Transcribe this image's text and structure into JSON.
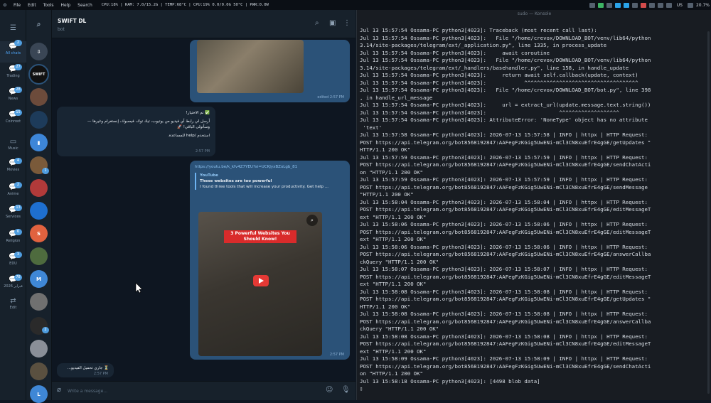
{
  "topbar": {
    "menu": [
      "File",
      "Edit",
      "Tools",
      "Help",
      "Search"
    ],
    "stats": "CPU:18% | RAM: 7.0/15.2G | TEMP:68°C | CPU:19% 0.0/0.0G 50°C | PWR:0.0W",
    "keyboard": "US",
    "battery": "20.7%"
  },
  "folders": [
    {
      "label": "All chats",
      "icon": "chat-bubbles-icon",
      "badge": "2",
      "active": true
    },
    {
      "label": "Trading",
      "icon": "chat-bubbles-icon",
      "badge": "27"
    },
    {
      "label": "News",
      "icon": "chat-bubbles-icon",
      "badge": "28"
    },
    {
      "label": "Coinroot",
      "icon": "chat-bubbles-icon",
      "badge": "15"
    },
    {
      "label": "Music",
      "icon": "folder-icon",
      "badge": ""
    },
    {
      "label": "Movies",
      "icon": "chat-bubbles-icon",
      "badge": "4"
    },
    {
      "label": "Anime",
      "icon": "chat-bubbles-icon",
      "badge": "2"
    },
    {
      "label": "Services",
      "icon": "chat-bubbles-icon",
      "badge": "13"
    },
    {
      "label": "Religion",
      "icon": "chat-bubbles-icon",
      "badge": "6"
    },
    {
      "label": "EDU",
      "icon": "chat-bubbles-icon",
      "badge": "3"
    },
    {
      "label": "2026 فبراير",
      "icon": "chat-bubbles-icon",
      "badge": "78"
    },
    {
      "label": "Edit",
      "icon": "sliders-icon",
      "badge": ""
    }
  ],
  "chats": [
    {
      "initial": "",
      "color": "#3a4655",
      "badge": ""
    },
    {
      "initial": "SWIFT",
      "color": "#111111",
      "badge": "",
      "selected": true
    },
    {
      "initial": "",
      "color": "#6c4b3b",
      "badge": ""
    },
    {
      "initial": "",
      "color": "#1d3b5a",
      "badge": ""
    },
    {
      "initial": "",
      "color": "#3d86d8",
      "badge": ""
    },
    {
      "initial": "",
      "color": "#7a5a3a",
      "badge": "1"
    },
    {
      "initial": "",
      "color": "#b13a3a",
      "badge": ""
    },
    {
      "initial": "",
      "color": "#1e6fd0",
      "badge": ""
    },
    {
      "initial": "S",
      "color": "#e1623f",
      "badge": ""
    },
    {
      "initial": "",
      "color": "#4e6b3e",
      "badge": ""
    },
    {
      "initial": "M",
      "color": "#3f87d6",
      "badge": ""
    },
    {
      "initial": "",
      "color": "#707070",
      "badge": ""
    },
    {
      "initial": "",
      "color": "#2a2a2a",
      "badge": "2"
    },
    {
      "initial": "",
      "color": "#8a8f98",
      "badge": ""
    },
    {
      "initial": "",
      "color": "#5a5040",
      "badge": ""
    },
    {
      "initial": "L",
      "color": "#3f87d6",
      "badge": ""
    }
  ],
  "chat": {
    "title": "SWIFT DL",
    "subtitle": "bot",
    "messages": {
      "first_time": "edited 2:57 PM",
      "welcome": "✅ تم الاختيار!",
      "welcome_body1": "أرسل لي رابط أي فيديو من يوتيوب، تيك توك، فيسبوك، إنستغرام وغيرها —",
      "welcome_body2": "وسأتولى الباقي! 🚀",
      "welcome_help": "استخدم /help للمساعدة.",
      "welcome_time": "2:57 PM",
      "link": "https://youtu.be/k_kfv4Z7YEU?si=UCKJyxBZoLgb_81",
      "preview_site": "YouTube",
      "preview_title": "These websites are too powerful",
      "preview_desc": "I found three tools that will increase your productivity. Get help ...",
      "video_caption": "3 Powerful Websites You Should Know!",
      "link_time": "2:57 PM",
      "loading": "⏳ جاري تحميل الفيديو...",
      "loading_time": "2:57 PM"
    },
    "composer_placeholder": "Write a message..."
  },
  "terminal": {
    "title": "sudo — Konsole",
    "lines": [
      "Jul 13 15:57:54 Ossama-PC python3[4023]: Traceback (most recent call last):",
      "Jul 13 15:57:54 Ossama-PC python3[4023]:   File \"/home/crevox/DOWNLOAD_BOT/venv/lib64/python",
      "3.14/site-packages/telegram/ext/_application.py\", line 1335, in process_update",
      "Jul 13 15:57:54 Ossama-PC python3[4023]:     await coroutine",
      "Jul 13 15:57:54 Ossama-PC python3[4023]:   File \"/home/crevox/DOWNLOAD_BOT/venv/lib64/python",
      "3.14/site-packages/telegram/ext/_handlers/basehandler.py\", line 158, in handle_update",
      "Jul 13 15:57:54 Ossama-PC python3[4023]:     return await self.callback(update, context)",
      "Jul 13 15:57:54 Ossama-PC python3[4023]:            ^^^^^^^^^^^^^^^^^^^^^^^^^^^^^^^^^^^^",
      "Jul 13 15:57:54 Ossama-PC python3[4023]:   File \"/home/crevox/DOWNLOAD_BOT/bot.py\", line 398",
      ", in handle_url_message",
      "Jul 13 15:57:54 Ossama-PC python3[4023]:     url = extract_url(update.message.text.string())",
      "Jul 13 15:57:54 Ossama-PC python3[4023]:                       ^^^^^^^^^^^^^^^^^^^",
      "Jul 13 15:57:54 Ossama-PC python3[4023]: AttributeError: 'NoneType' object has no attribute",
      " 'text'",
      "Jul 13 15:57:58 Ossama-PC python3[4023]: 2026-07-13 15:57:58 | INFO | httpx | HTTP Request:",
      "POST https://api.telegram.org/bot8568192847:AAFegFzKGig5UwENi-mCl3CN8xuEfrE4gGE/getUpdates \"",
      "HTTP/1.1 200 OK\"",
      "Jul 13 15:57:59 Ossama-PC python3[4023]: 2026-07-13 15:57:59 | INFO | httpx | HTTP Request:",
      "POST https://api.telegram.org/bot8568192847:AAFegFzKGig5UwENi-mCl3CN8xuEfrE4gGE/sendChatActi",
      "on \"HTTP/1.1 200 OK\"",
      "Jul 13 15:57:59 Ossama-PC python3[4023]: 2026-07-13 15:57:59 | INFO | httpx | HTTP Request:",
      "POST https://api.telegram.org/bot8568192847:AAFegFzKGig5UwENi-mCl3CN8xuEfrE4gGE/sendMessage",
      "\"HTTP/1.1 200 OK\"",
      "Jul 13 15:58:04 Ossama-PC python3[4023]: 2026-07-13 15:58:04 | INFO | httpx | HTTP Request:",
      "POST https://api.telegram.org/bot8568192847:AAFegFzKGig5UwENi-mCl3CN8xuEfrE4gGE/editMessageT",
      "ext \"HTTP/1.1 200 OK\"",
      "Jul 13 15:58:06 Ossama-PC python3[4023]: 2026-07-13 15:58:06 | INFO | httpx | HTTP Request:",
      "POST https://api.telegram.org/bot8568192847:AAFegFzKGig5UwENi-mCl3CN8xuEfrE4gGE/editMessageT",
      "ext \"HTTP/1.1 200 OK\"",
      "Jul 13 15:58:06 Ossama-PC python3[4023]: 2026-07-13 15:58:06 | INFO | httpx | HTTP Request:",
      "POST https://api.telegram.org/bot8568192847:AAFegFzKGig5UwENi-mCl3CN8xuEfrE4gGE/answerCallba",
      "ckQuery \"HTTP/1.1 200 OK\"",
      "Jul 13 15:58:07 Ossama-PC python3[4023]: 2026-07-13 15:58:07 | INFO | httpx | HTTP Request:",
      "POST https://api.telegram.org/bot8568192847:AAFegFzKGig5UwENi-mCl3CN8xuEfrE4gGE/editMessageT",
      "ext \"HTTP/1.1 200 OK\"",
      "Jul 13 15:58:08 Ossama-PC python3[4023]: 2026-07-13 15:58:08 | INFO | httpx | HTTP Request:",
      "POST https://api.telegram.org/bot8568192847:AAFegFzKGig5UwENi-mCl3CN8xuEfrE4gGE/getUpdates \"",
      "HTTP/1.1 200 OK\"",
      "Jul 13 15:58:08 Ossama-PC python3[4023]: 2026-07-13 15:58:08 | INFO | httpx | HTTP Request:",
      "POST https://api.telegram.org/bot8568192847:AAFegFzKGig5UwENi-mCl3CN8xuEfrE4gGE/answerCallba",
      "ckQuery \"HTTP/1.1 200 OK\"",
      "Jul 13 15:58:08 Ossama-PC python3[4023]: 2026-07-13 15:58:08 | INFO | httpx | HTTP Request:",
      "POST https://api.telegram.org/bot8568192847:AAFegFzKGig5UwENi-mCl3CN8xuEfrE4gGE/editMessageT",
      "ext \"HTTP/1.1 200 OK\"",
      "Jul 13 15:58:09 Ossama-PC python3[4023]: 2026-07-13 15:58:09 | INFO | httpx | HTTP Request:",
      "POST https://api.telegram.org/bot8568192847:AAFegFzKGig5UwENi-mCl3CN8xuEfrE4gGE/sendChatActi",
      "on \"HTTP/1.1 200 OK\"",
      "Jul 13 15:58:18 Ossama-PC python3[4023]: [4498 blob data]",
      "▯"
    ]
  }
}
